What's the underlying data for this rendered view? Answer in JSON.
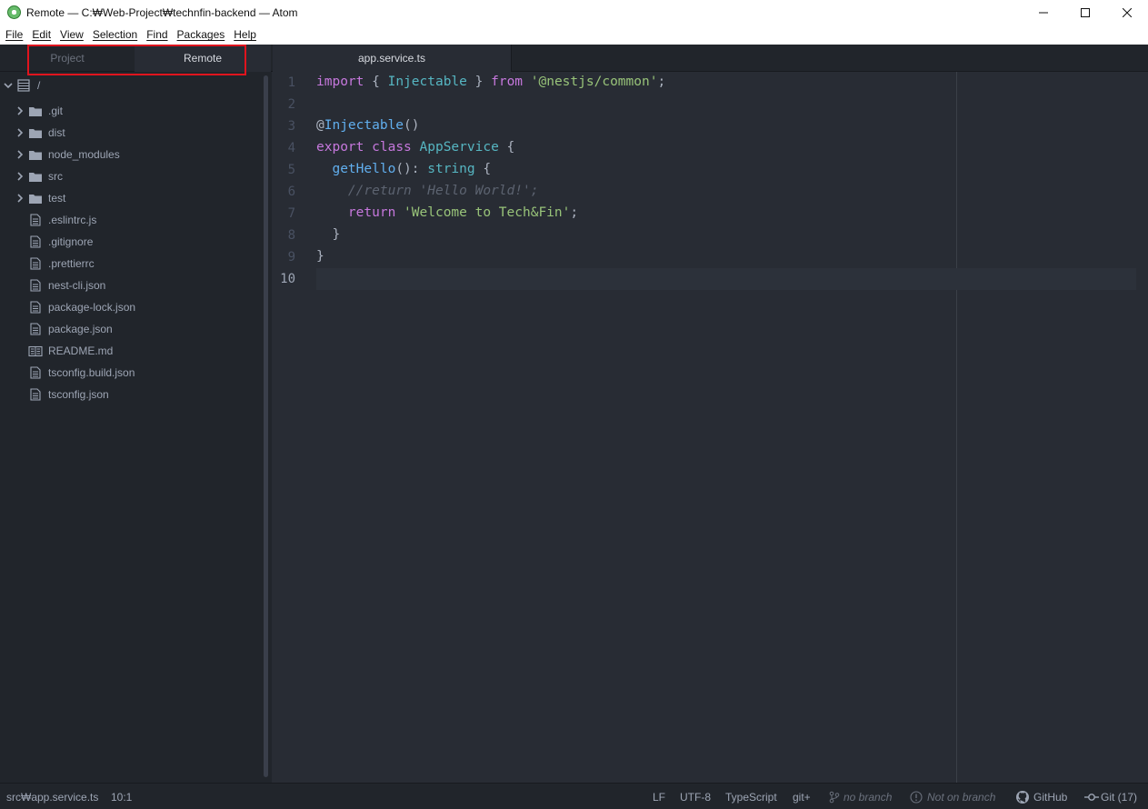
{
  "window": {
    "title": "Remote — C:₩Web-Project₩technfin-backend — Atom",
    "controls": {
      "minimize": "minimize-icon",
      "maximize": "maximize-icon",
      "close": "close-icon"
    }
  },
  "menu": [
    "File",
    "Edit",
    "View",
    "Selection",
    "Find",
    "Packages",
    "Help"
  ],
  "dock": {
    "tabs": [
      "Project",
      "Remote"
    ],
    "active_tab": "Remote",
    "root": {
      "label": "/"
    },
    "folders": [
      ".git",
      "dist",
      "node_modules",
      "src",
      "test"
    ],
    "files": [
      {
        "name": ".eslintrc.js",
        "icon": "file-icon"
      },
      {
        "name": ".gitignore",
        "icon": "file-icon"
      },
      {
        "name": ".prettierrc",
        "icon": "file-icon"
      },
      {
        "name": "nest-cli.json",
        "icon": "file-icon"
      },
      {
        "name": "package-lock.json",
        "icon": "file-icon"
      },
      {
        "name": "package.json",
        "icon": "file-icon"
      },
      {
        "name": "README.md",
        "icon": "book-icon"
      },
      {
        "name": "tsconfig.build.json",
        "icon": "file-icon"
      },
      {
        "name": "tsconfig.json",
        "icon": "file-icon"
      }
    ]
  },
  "editor": {
    "tab": "app.service.ts",
    "line_numbers": [
      "1",
      "2",
      "3",
      "4",
      "5",
      "6",
      "7",
      "8",
      "9",
      "10"
    ],
    "active_line": "10",
    "code": {
      "l1": {
        "import": "import",
        "open": " { ",
        "name": "Injectable",
        "close": " } ",
        "from": "from",
        "sp": " ",
        "module": "'@nestjs/common'",
        "semi": ";"
      },
      "l3": {
        "at": "@",
        "decorator": "Injectable",
        "parens": "()"
      },
      "l4": {
        "export": "export",
        "sp1": " ",
        "class": "class",
        "sp2": " ",
        "name": "AppService",
        "brace": " {"
      },
      "l5": {
        "indent": "  ",
        "method": "getHello",
        "sig": "(): ",
        "type": "string",
        "brace": " {"
      },
      "l6": {
        "indent": "    ",
        "comment": "//return 'Hello World!';"
      },
      "l7": {
        "indent": "    ",
        "return": "return",
        "sp": " ",
        "value": "'Welcome to Tech&Fin'",
        "semi": ";"
      },
      "l8": {
        "text": "  }"
      },
      "l9": {
        "text": "}"
      }
    }
  },
  "status": {
    "path": "src₩app.service.ts",
    "cursor": "10:1",
    "line_ending": "LF",
    "encoding": "UTF-8",
    "grammar": "TypeScript",
    "git_plus": "git+",
    "branch": "no branch",
    "branch_status": "Not on branch",
    "github": "GitHub",
    "git": "Git (17)"
  },
  "colors": {
    "accent_highlight": "#e0141e",
    "keyword": "#c678dd",
    "type": "#56b6c2",
    "string": "#98c379",
    "function": "#61afef",
    "comment": "#5c6370"
  }
}
